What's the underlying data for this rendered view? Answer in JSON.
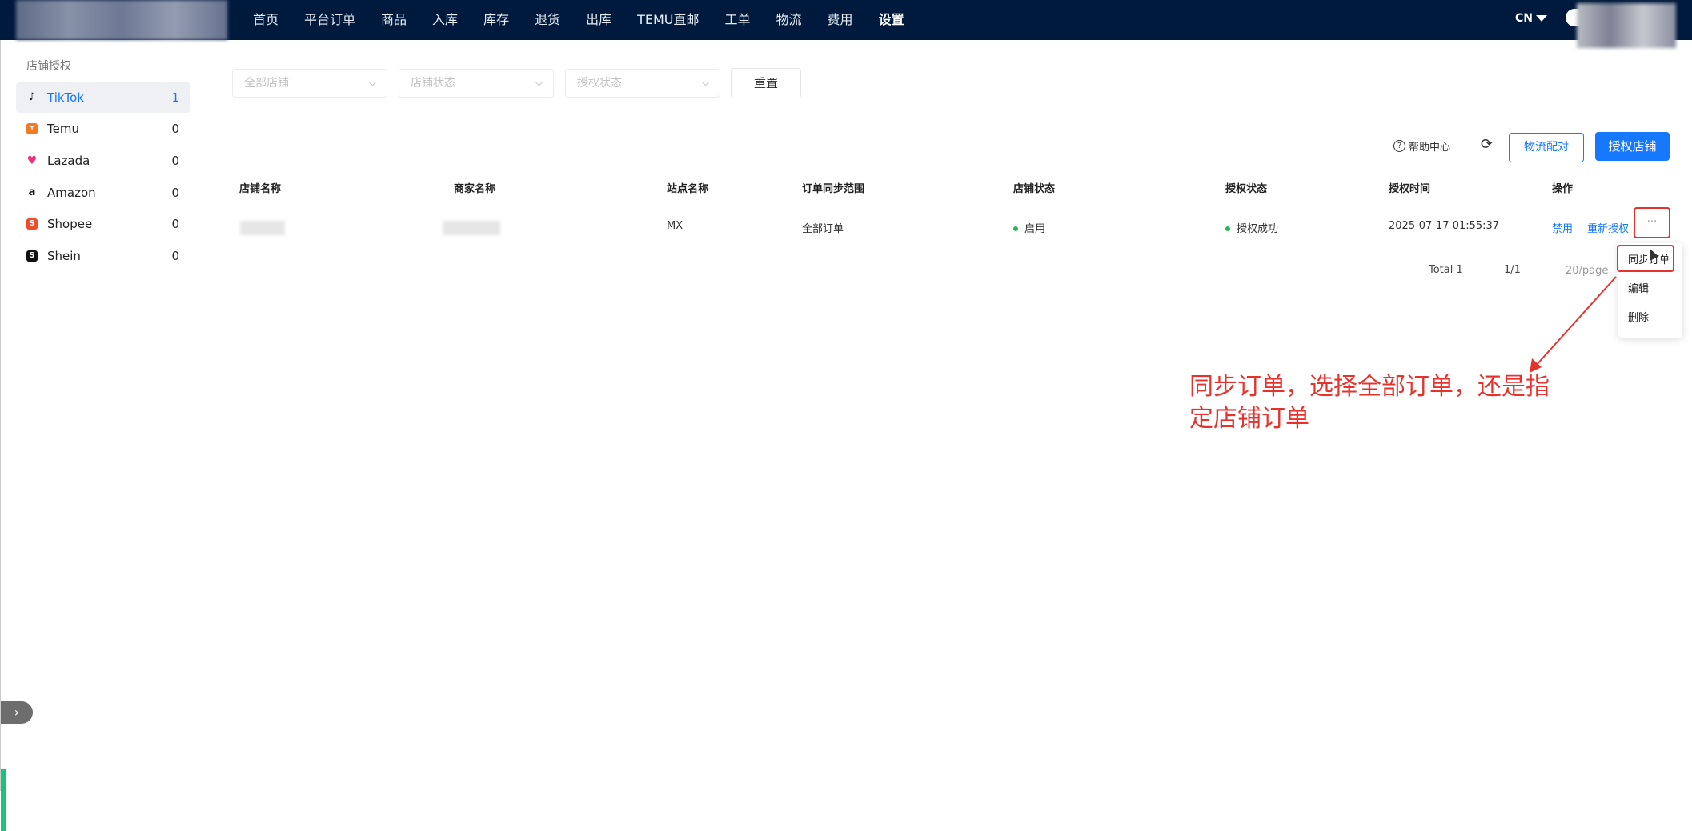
{
  "header": {
    "nav": [
      "首页",
      "平台订单",
      "商品",
      "入库",
      "库存",
      "退货",
      "出库",
      "TEMU直邮",
      "工单",
      "物流",
      "费用",
      "设置"
    ],
    "active_nav": "设置",
    "lang": "CN"
  },
  "sidebar": {
    "title": "店铺授权",
    "items": [
      {
        "label": "TikTok",
        "count": "1"
      },
      {
        "label": "Temu",
        "count": "0"
      },
      {
        "label": "Lazada",
        "count": "0"
      },
      {
        "label": "Amazon",
        "count": "0"
      },
      {
        "label": "Shopee",
        "count": "0"
      },
      {
        "label": "Shein",
        "count": "0"
      }
    ]
  },
  "filters": {
    "store_placeholder": "全部店铺",
    "store_status_placeholder": "店铺状态",
    "auth_status_placeholder": "授权状态",
    "reset_label": "重置"
  },
  "toolbar": {
    "help_label": "帮助中心",
    "logistics_match_label": "物流配对",
    "authorize_label": "授权店铺"
  },
  "table": {
    "columns": [
      "店铺名称",
      "商家名称",
      "站点名称",
      "订单同步范围",
      "店铺状态",
      "授权状态",
      "授权时间",
      "操作"
    ],
    "rows": [
      {
        "site": "MX",
        "sync_range": "全部订单",
        "store_status": "启用",
        "auth_status": "授权成功",
        "auth_time": "2025-07-17 01:55:37",
        "actions": [
          "禁用",
          "重新授权",
          "..."
        ]
      }
    ]
  },
  "pagination": {
    "total": "Total 1",
    "pages": "1/1",
    "page_size": "20/page"
  },
  "action_menu": {
    "items": [
      "同步订单",
      "编辑",
      "删除"
    ]
  },
  "annotation": {
    "line1": "同步订单，选择全部订单，还是指",
    "line2": "定店铺订单"
  },
  "colors": {
    "nav_bg": "#001a3d",
    "primary": "#1677ff",
    "annotation": "#e5322d",
    "status_dot": "#1fb955"
  },
  "icons": {
    "tiktok": "tiktok-icon",
    "temu": "temu-icon",
    "lazada": "lazada-heart-icon",
    "amazon": "amazon-icon",
    "shopee": "shopee-bag-icon",
    "shein": "shein-icon"
  }
}
